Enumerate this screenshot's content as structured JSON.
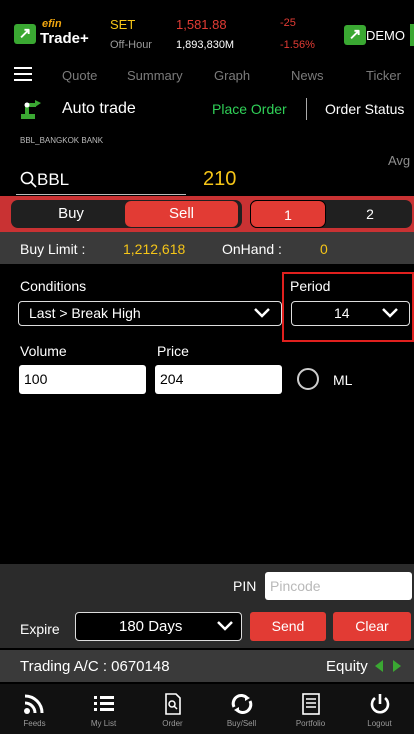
{
  "market": {
    "logo_top": "efin",
    "logo_main": "Trade+",
    "index_name": "SET",
    "index_value": "1,581.88",
    "change": "-25",
    "session": "Off-Hour",
    "volume": "1,893,830M",
    "change_pct": "-1.56%",
    "mode": "DEMO"
  },
  "nav": {
    "items": [
      "Quote",
      "Summary",
      "Graph",
      "News",
      "Ticker"
    ]
  },
  "header": {
    "title": "Auto trade",
    "place_order": "Place Order",
    "order_status": "Order Status"
  },
  "stock": {
    "full_name": "BBL_BANGKOK BANK",
    "avg_label": "Avg",
    "symbol": "BBL",
    "last_price": "210"
  },
  "side": {
    "buy": "Buy",
    "sell": "Sell",
    "selected": "Sell",
    "pages": [
      "1",
      "2"
    ]
  },
  "limits": {
    "buy_limit_label": "Buy Limit :",
    "buy_limit_value": "1,212,618",
    "onhand_label": "OnHand :",
    "onhand_value": "0"
  },
  "form": {
    "conditions_label": "Conditions",
    "condition_value": "Last > Break High",
    "period_label": "Period",
    "period_value": "14",
    "volume_label": "Volume",
    "volume_value": "100",
    "price_label": "Price",
    "price_value": "204",
    "ml_label": "ML"
  },
  "submit": {
    "pin_label": "PIN",
    "pin_placeholder": "Pincode",
    "expire_label": "Expire",
    "expire_value": "180 Days",
    "send": "Send",
    "clear": "Clear"
  },
  "account": {
    "label": "Trading A/C :",
    "number": "0670148",
    "type": "Equity"
  },
  "tabs": [
    {
      "label": "Feeds",
      "icon": "rss-icon"
    },
    {
      "label": "My List",
      "icon": "list-icon"
    },
    {
      "label": "Order",
      "icon": "document-search-icon"
    },
    {
      "label": "Buy/Sell",
      "icon": "exchange-icon"
    },
    {
      "label": "Portfolio",
      "icon": "portfolio-icon"
    },
    {
      "label": "Logout",
      "icon": "power-icon"
    }
  ],
  "colors": {
    "accent_red": "#e23b34",
    "green": "#30d158",
    "yellow": "#f5c518"
  }
}
